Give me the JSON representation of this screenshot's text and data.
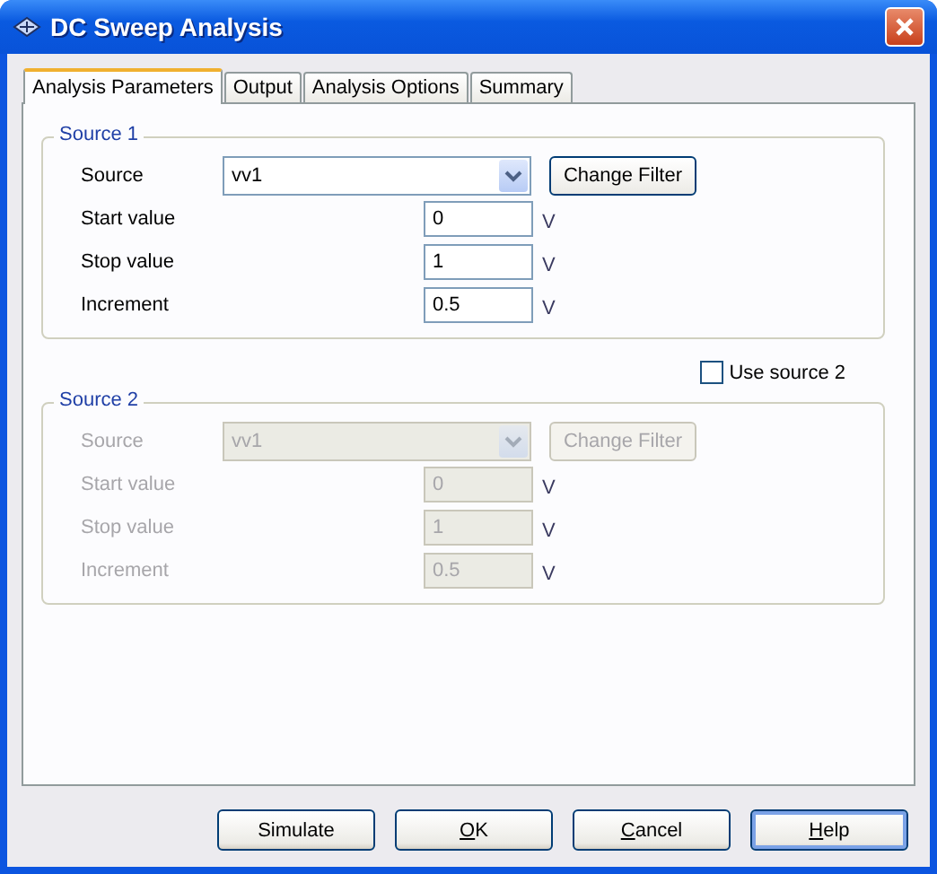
{
  "window": {
    "title": "DC Sweep Analysis"
  },
  "tabs": [
    {
      "label": "Analysis Parameters",
      "selected": true
    },
    {
      "label": "Output",
      "selected": false
    },
    {
      "label": "Analysis Options",
      "selected": false
    },
    {
      "label": "Summary",
      "selected": false
    }
  ],
  "groups": [
    {
      "title": "Source 1",
      "disabled": false,
      "source_label": "Source",
      "source_value": "vv1",
      "filter_button": "Change Filter",
      "rows": [
        {
          "label": "Start value",
          "value": "0",
          "unit": "V"
        },
        {
          "label": "Stop value",
          "value": "1",
          "unit": "V"
        },
        {
          "label": "Increment",
          "value": "0.5",
          "unit": "V"
        }
      ]
    },
    {
      "title": "Source 2",
      "disabled": true,
      "source_label": "Source",
      "source_value": "vv1",
      "filter_button": "Change Filter",
      "rows": [
        {
          "label": "Start value",
          "value": "0",
          "unit": "V"
        },
        {
          "label": "Stop value",
          "value": "1",
          "unit": "V"
        },
        {
          "label": "Increment",
          "value": "0.5",
          "unit": "V"
        }
      ]
    }
  ],
  "use_source_2": {
    "label": "Use source 2",
    "checked": false
  },
  "buttons": [
    {
      "label": "Simulate",
      "focused": false
    },
    {
      "label": "OK",
      "access_key_underlined": true,
      "focused": false
    },
    {
      "label": "Cancel",
      "access_key_underlined": true,
      "focused": false
    },
    {
      "label": "Help",
      "access_key_underlined": true,
      "focused": true
    }
  ]
}
